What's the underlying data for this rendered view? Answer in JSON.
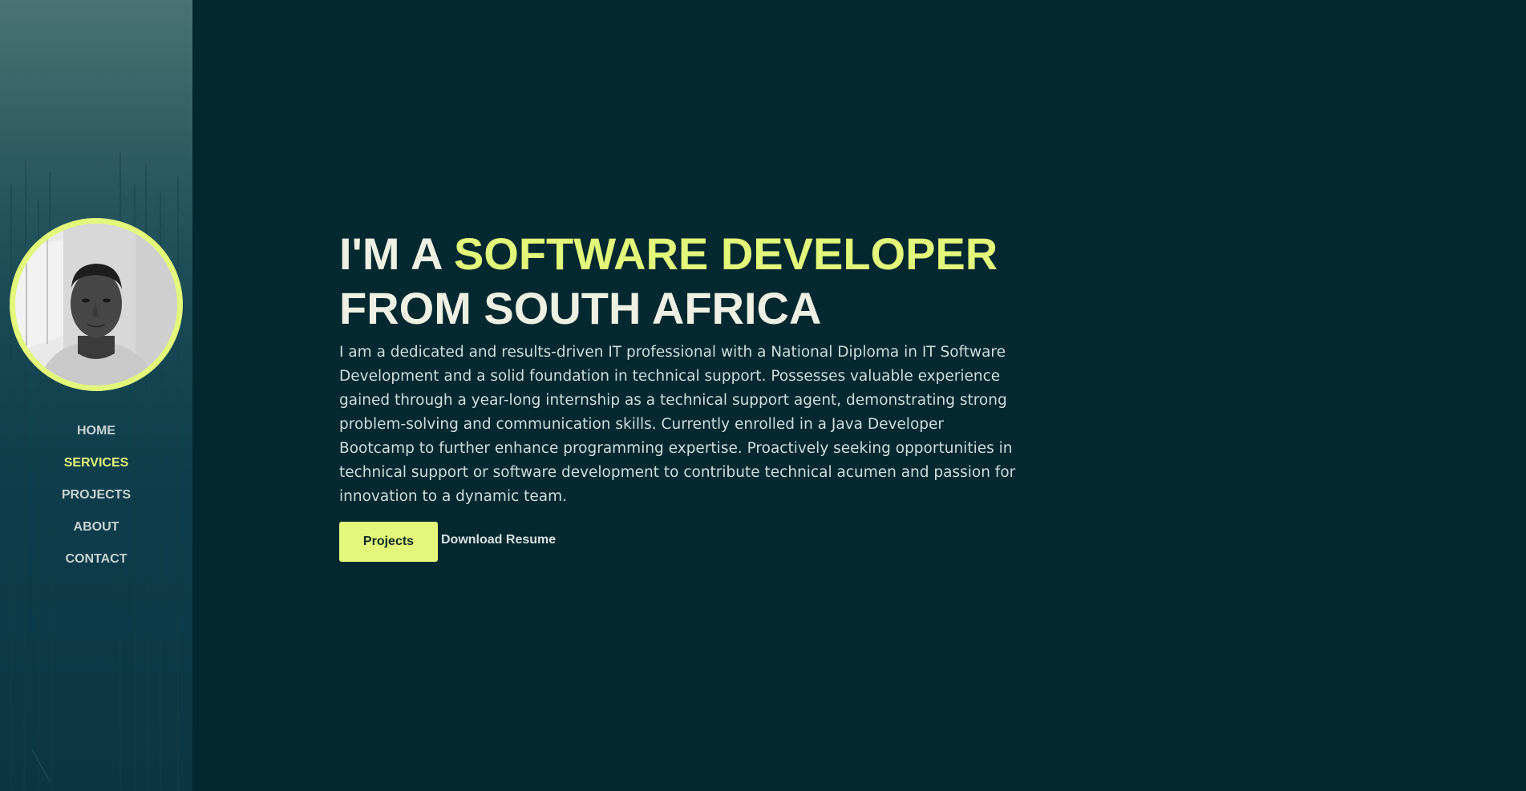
{
  "sidebar": {
    "nav": [
      {
        "label": "HOME",
        "active": false
      },
      {
        "label": "SERVICES",
        "active": true
      },
      {
        "label": "PROJECTS",
        "active": false
      },
      {
        "label": "ABOUT",
        "active": false
      },
      {
        "label": "CONTACT",
        "active": false
      }
    ]
  },
  "hero": {
    "headline_prefix": "I'M A ",
    "headline_highlight": "SOFTWARE DEVELOPER",
    "headline_suffix": "FROM SOUTH AFRICA",
    "intro": "I am a dedicated and results-driven IT professional with a National Diploma in IT Software Development and a solid foundation in technical support. Possesses valuable experience gained through a year-long internship as a technical support agent, demonstrating strong problem-solving and communication skills. Currently enrolled in a Java Developer Bootcamp to further enhance programming expertise. Proactively seeking opportunities in technical support or software development to contribute technical acumen and passion for innovation to a dynamic team.",
    "primary_button": "Projects",
    "secondary_link": "Download Resume"
  },
  "colors": {
    "accent": "#e3f87a",
    "background": "#03282f",
    "text": "#eef0e3"
  }
}
